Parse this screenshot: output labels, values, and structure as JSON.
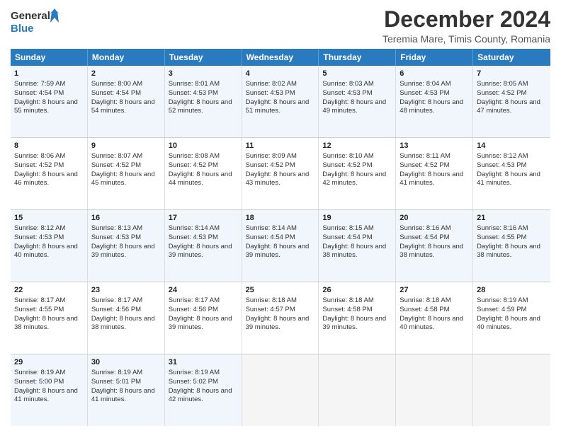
{
  "logo": {
    "line1": "General",
    "line2": "Blue"
  },
  "title": "December 2024",
  "subtitle": "Teremia Mare, Timis County, Romania",
  "header_days": [
    "Sunday",
    "Monday",
    "Tuesday",
    "Wednesday",
    "Thursday",
    "Friday",
    "Saturday"
  ],
  "weeks": [
    [
      {
        "day": "1",
        "rise": "Sunrise: 7:59 AM",
        "set": "Sunset: 4:54 PM",
        "light": "Daylight: 8 hours and 55 minutes."
      },
      {
        "day": "2",
        "rise": "Sunrise: 8:00 AM",
        "set": "Sunset: 4:54 PM",
        "light": "Daylight: 8 hours and 54 minutes."
      },
      {
        "day": "3",
        "rise": "Sunrise: 8:01 AM",
        "set": "Sunset: 4:53 PM",
        "light": "Daylight: 8 hours and 52 minutes."
      },
      {
        "day": "4",
        "rise": "Sunrise: 8:02 AM",
        "set": "Sunset: 4:53 PM",
        "light": "Daylight: 8 hours and 51 minutes."
      },
      {
        "day": "5",
        "rise": "Sunrise: 8:03 AM",
        "set": "Sunset: 4:53 PM",
        "light": "Daylight: 8 hours and 49 minutes."
      },
      {
        "day": "6",
        "rise": "Sunrise: 8:04 AM",
        "set": "Sunset: 4:53 PM",
        "light": "Daylight: 8 hours and 48 minutes."
      },
      {
        "day": "7",
        "rise": "Sunrise: 8:05 AM",
        "set": "Sunset: 4:52 PM",
        "light": "Daylight: 8 hours and 47 minutes."
      }
    ],
    [
      {
        "day": "8",
        "rise": "Sunrise: 8:06 AM",
        "set": "Sunset: 4:52 PM",
        "light": "Daylight: 8 hours and 46 minutes."
      },
      {
        "day": "9",
        "rise": "Sunrise: 8:07 AM",
        "set": "Sunset: 4:52 PM",
        "light": "Daylight: 8 hours and 45 minutes."
      },
      {
        "day": "10",
        "rise": "Sunrise: 8:08 AM",
        "set": "Sunset: 4:52 PM",
        "light": "Daylight: 8 hours and 44 minutes."
      },
      {
        "day": "11",
        "rise": "Sunrise: 8:09 AM",
        "set": "Sunset: 4:52 PM",
        "light": "Daylight: 8 hours and 43 minutes."
      },
      {
        "day": "12",
        "rise": "Sunrise: 8:10 AM",
        "set": "Sunset: 4:52 PM",
        "light": "Daylight: 8 hours and 42 minutes."
      },
      {
        "day": "13",
        "rise": "Sunrise: 8:11 AM",
        "set": "Sunset: 4:52 PM",
        "light": "Daylight: 8 hours and 41 minutes."
      },
      {
        "day": "14",
        "rise": "Sunrise: 8:12 AM",
        "set": "Sunset: 4:53 PM",
        "light": "Daylight: 8 hours and 41 minutes."
      }
    ],
    [
      {
        "day": "15",
        "rise": "Sunrise: 8:12 AM",
        "set": "Sunset: 4:53 PM",
        "light": "Daylight: 8 hours and 40 minutes."
      },
      {
        "day": "16",
        "rise": "Sunrise: 8:13 AM",
        "set": "Sunset: 4:53 PM",
        "light": "Daylight: 8 hours and 39 minutes."
      },
      {
        "day": "17",
        "rise": "Sunrise: 8:14 AM",
        "set": "Sunset: 4:53 PM",
        "light": "Daylight: 8 hours and 39 minutes."
      },
      {
        "day": "18",
        "rise": "Sunrise: 8:14 AM",
        "set": "Sunset: 4:54 PM",
        "light": "Daylight: 8 hours and 39 minutes."
      },
      {
        "day": "19",
        "rise": "Sunrise: 8:15 AM",
        "set": "Sunset: 4:54 PM",
        "light": "Daylight: 8 hours and 38 minutes."
      },
      {
        "day": "20",
        "rise": "Sunrise: 8:16 AM",
        "set": "Sunset: 4:54 PM",
        "light": "Daylight: 8 hours and 38 minutes."
      },
      {
        "day": "21",
        "rise": "Sunrise: 8:16 AM",
        "set": "Sunset: 4:55 PM",
        "light": "Daylight: 8 hours and 38 minutes."
      }
    ],
    [
      {
        "day": "22",
        "rise": "Sunrise: 8:17 AM",
        "set": "Sunset: 4:55 PM",
        "light": "Daylight: 8 hours and 38 minutes."
      },
      {
        "day": "23",
        "rise": "Sunrise: 8:17 AM",
        "set": "Sunset: 4:56 PM",
        "light": "Daylight: 8 hours and 38 minutes."
      },
      {
        "day": "24",
        "rise": "Sunrise: 8:17 AM",
        "set": "Sunset: 4:56 PM",
        "light": "Daylight: 8 hours and 39 minutes."
      },
      {
        "day": "25",
        "rise": "Sunrise: 8:18 AM",
        "set": "Sunset: 4:57 PM",
        "light": "Daylight: 8 hours and 39 minutes."
      },
      {
        "day": "26",
        "rise": "Sunrise: 8:18 AM",
        "set": "Sunset: 4:58 PM",
        "light": "Daylight: 8 hours and 39 minutes."
      },
      {
        "day": "27",
        "rise": "Sunrise: 8:18 AM",
        "set": "Sunset: 4:58 PM",
        "light": "Daylight: 8 hours and 40 minutes."
      },
      {
        "day": "28",
        "rise": "Sunrise: 8:19 AM",
        "set": "Sunset: 4:59 PM",
        "light": "Daylight: 8 hours and 40 minutes."
      }
    ],
    [
      {
        "day": "29",
        "rise": "Sunrise: 8:19 AM",
        "set": "Sunset: 5:00 PM",
        "light": "Daylight: 8 hours and 41 minutes."
      },
      {
        "day": "30",
        "rise": "Sunrise: 8:19 AM",
        "set": "Sunset: 5:01 PM",
        "light": "Daylight: 8 hours and 41 minutes."
      },
      {
        "day": "31",
        "rise": "Sunrise: 8:19 AM",
        "set": "Sunset: 5:02 PM",
        "light": "Daylight: 8 hours and 42 minutes."
      },
      null,
      null,
      null,
      null
    ]
  ]
}
